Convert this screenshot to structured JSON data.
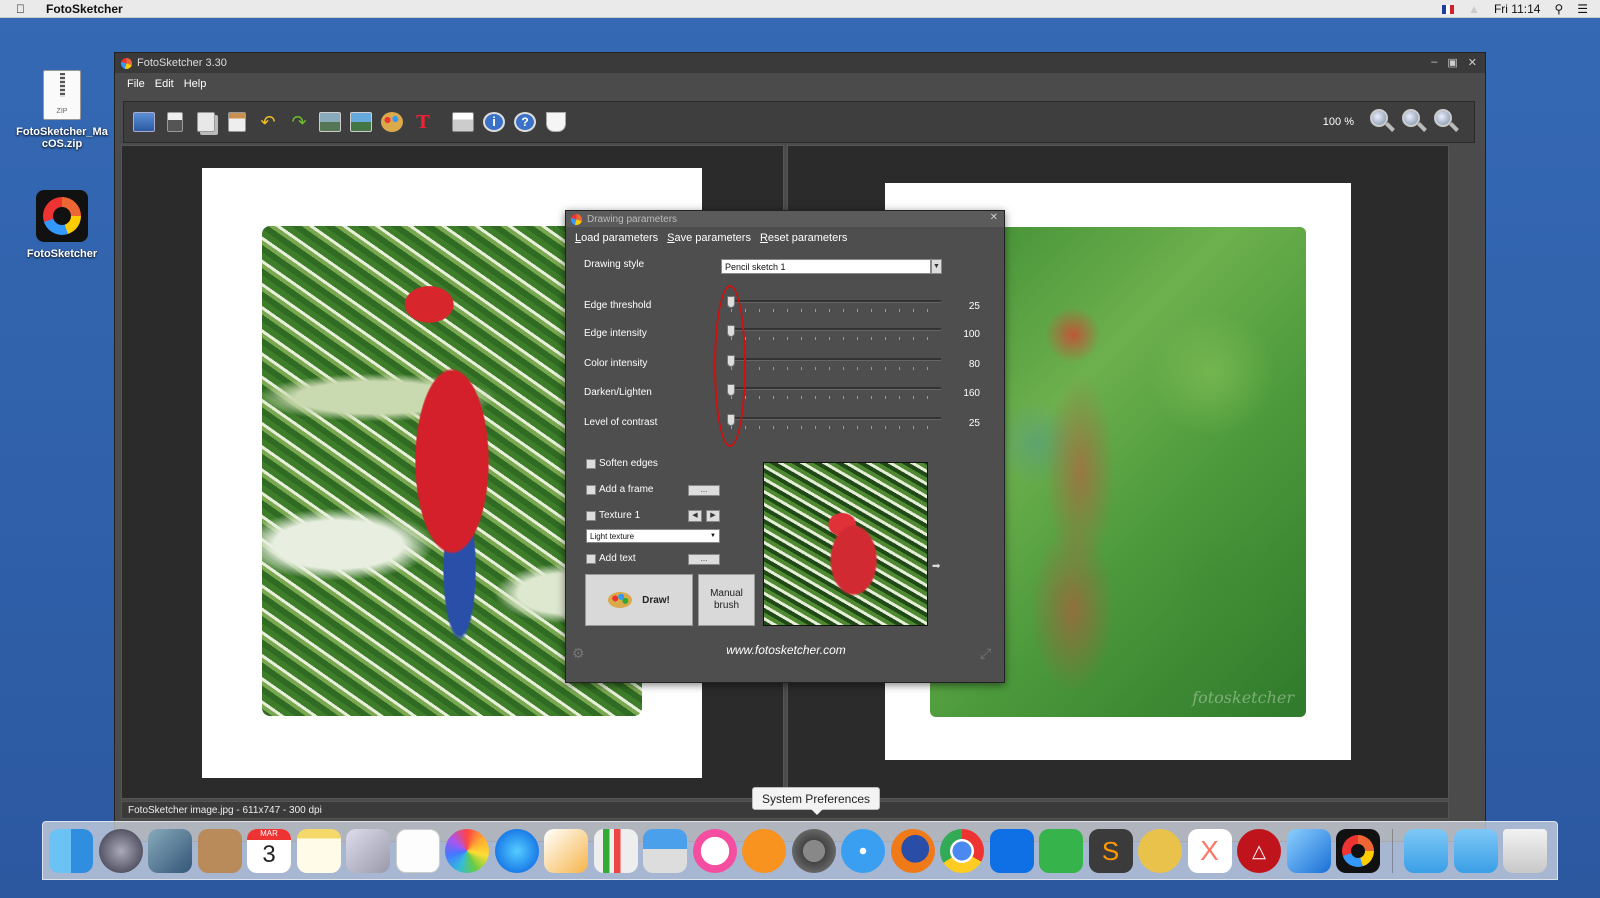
{
  "menubar": {
    "app_name": "FotoSketcher",
    "clock": "Fri 11:14"
  },
  "desktop": {
    "icons": [
      {
        "label": "FotoSketcher_MacOS.zip",
        "badge": "ZIP"
      },
      {
        "label": "FotoSketcher"
      }
    ]
  },
  "window": {
    "title": "FotoSketcher 3.30",
    "menu": [
      "File",
      "Edit",
      "Help"
    ],
    "zoom_level": "100 %",
    "status": "FotoSketcher image.jpg - 611x747 - 300 dpi",
    "signature": "fotosketcher"
  },
  "dialog": {
    "title": "Drawing parameters",
    "menu": [
      "Load parameters",
      "Save parameters",
      "Reset parameters"
    ],
    "drawing_style_label": "Drawing style",
    "drawing_style_value": "Pencil sketch 1",
    "params": [
      {
        "label": "Edge threshold",
        "value": "25"
      },
      {
        "label": "Edge intensity",
        "value": "100"
      },
      {
        "label": "Color intensity",
        "value": "80"
      },
      {
        "label": "Darken/Lighten",
        "value": "160"
      },
      {
        "label": "Level of contrast",
        "value": "25"
      }
    ],
    "options": {
      "soften_edges": "Soften edges",
      "add_frame": "Add a frame",
      "texture": "Texture 1",
      "texture_select": "Light texture",
      "add_text": "Add text"
    },
    "dots_label": "...",
    "draw_button": "Draw!",
    "manual_brush_line1": "Manual",
    "manual_brush_line2": "brush",
    "url": "www.fotosketcher.com"
  },
  "tooltip": "System Preferences",
  "dock": {
    "calendar_month": "MAR",
    "calendar_day": "3"
  }
}
